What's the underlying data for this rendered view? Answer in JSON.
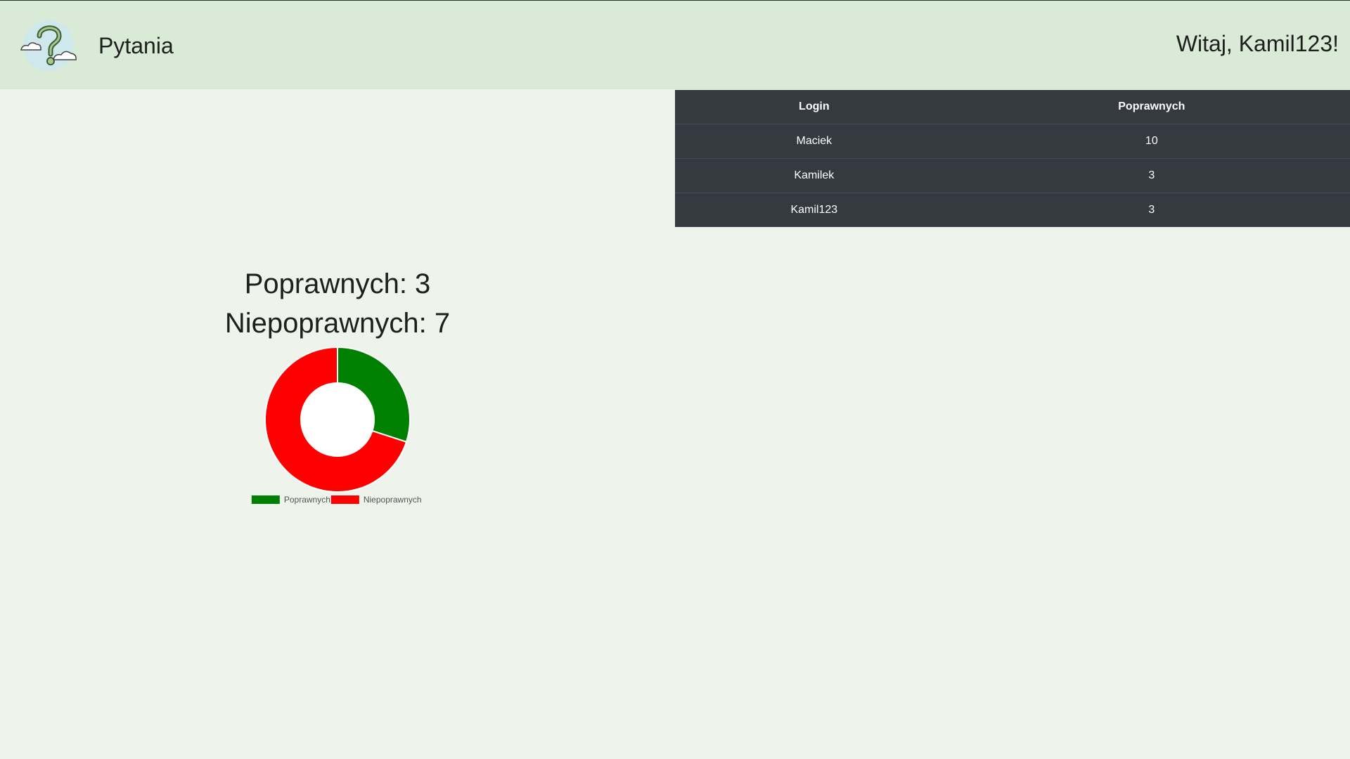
{
  "header": {
    "brand": "Pytania",
    "greeting": "Witaj, Kamil123!",
    "logo_icon": "question-clouds-icon"
  },
  "scoreboard": {
    "columns": [
      "Login",
      "Poprawnych"
    ],
    "rows": [
      {
        "login": "Maciek",
        "correct": "10"
      },
      {
        "login": "Kamilek",
        "correct": "3"
      },
      {
        "login": "Kamil123",
        "correct": "3"
      }
    ]
  },
  "stats": {
    "correct_text": "Poprawnych: 3",
    "incorrect_text": "Niepoprawnych: 7"
  },
  "chart_data": {
    "type": "pie",
    "categories": [
      "Poprawnych",
      "Niepoprawnych"
    ],
    "values": [
      3,
      7
    ],
    "colors": [
      "#008000",
      "#ff0000"
    ],
    "donut": true,
    "title": "",
    "legend": "bottom"
  }
}
